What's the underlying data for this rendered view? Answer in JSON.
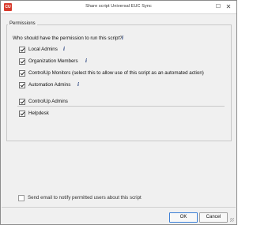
{
  "window": {
    "title": "Share script Universal EUC Sync",
    "app_icon_text": "CU"
  },
  "permissions": {
    "legend": "Permissions",
    "question": "Who should have the permission to run this script?",
    "items": [
      {
        "label": "Local Admins",
        "checked": true
      },
      {
        "label": "Organization Members",
        "checked": true
      },
      {
        "label": "ControlUp Monitors (select this to allow use of this script as an automated action)",
        "checked": true
      },
      {
        "label": "Automation Admins",
        "checked": true
      },
      {
        "label": "ControlUp Admins",
        "checked": true
      },
      {
        "label": "Helpdesk",
        "checked": true
      }
    ]
  },
  "email": {
    "label": "Send email to notify permitted users about this script",
    "checked": false
  },
  "buttons": {
    "ok": "OK",
    "cancel": "Cancel"
  }
}
